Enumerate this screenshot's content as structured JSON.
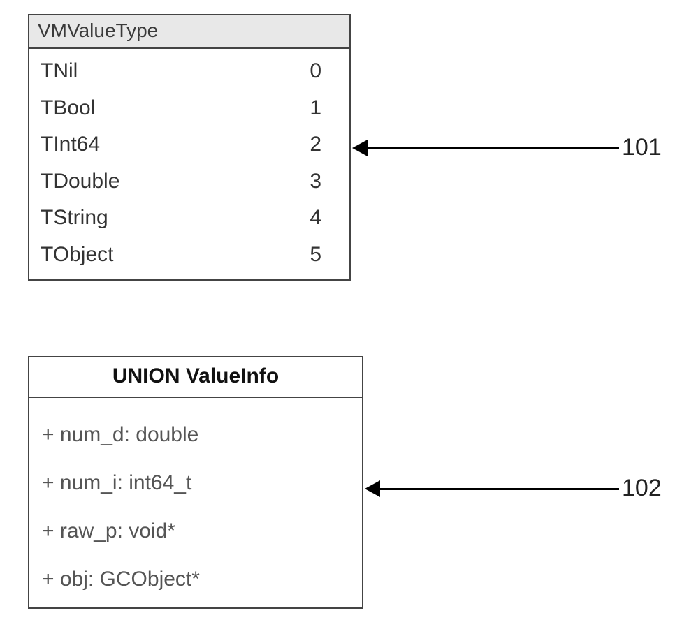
{
  "enum_box": {
    "title": "VMValueType",
    "rows": [
      {
        "name": "TNil",
        "value": "0"
      },
      {
        "name": "TBool",
        "value": "1"
      },
      {
        "name": "TInt64",
        "value": "2"
      },
      {
        "name": "TDouble",
        "value": "3"
      },
      {
        "name": "TString",
        "value": "4"
      },
      {
        "name": "TObject",
        "value": "5"
      }
    ]
  },
  "union_box": {
    "title": "UNION ValueInfo",
    "rows": [
      {
        "text": "+ num_d: double"
      },
      {
        "text": "+ num_i: int64_t"
      },
      {
        "text": "+ raw_p: void*"
      },
      {
        "text": "+ obj: GCObject*"
      }
    ]
  },
  "callouts": {
    "top": "101",
    "bottom": "102"
  }
}
